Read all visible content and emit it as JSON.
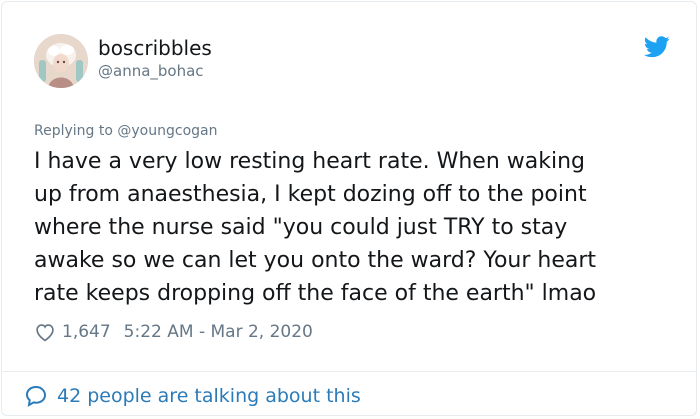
{
  "user": {
    "display_name": "boscribbles",
    "handle": "@anna_bohac",
    "avatar_icon": "user-avatar"
  },
  "brand": {
    "icon": "twitter-bird-icon",
    "color": "#1da1f2"
  },
  "reply": {
    "prefix": "Replying to ",
    "to": "@youngcogan"
  },
  "tweet": {
    "lines": [
      "I have a very low resting heart rate. When waking",
      "up from anaesthesia, I kept dozing off to the point",
      "where the nurse said \"you could just TRY to stay",
      "awake so we can let you onto the ward? Your heart",
      "rate keeps dropping off the face of the earth\" lmao"
    ]
  },
  "meta": {
    "likes": "1,647",
    "timestamp": "5:22 AM - Mar 2, 2020"
  },
  "footer": {
    "talking": "42 people are talking about this"
  },
  "colors": {
    "text": "#14171a",
    "muted": "#657786",
    "link": "#2b7bb9",
    "border": "#e6ecf0"
  }
}
